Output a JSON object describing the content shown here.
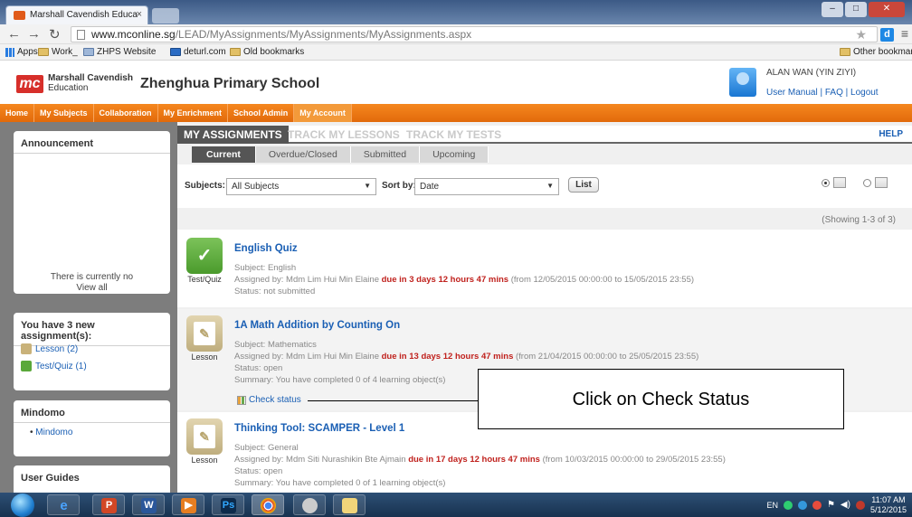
{
  "browser": {
    "tab_title": "Marshall Cavendish Educa",
    "tab_close": "×",
    "url_domain": "www.mconline.sg",
    "url_path": "/LEAD/MyAssignments/MyAssignments/MyAssignments.aspx",
    "bookmarks": [
      "Apps",
      "Work_",
      "ZHPS Website",
      "deturl.com",
      "Old bookmarks"
    ],
    "other_bookmarks": "Other bookmarks",
    "ext_label": "d"
  },
  "header": {
    "logo_mark": "mc",
    "brand_line1": "Marshall Cavendish",
    "brand_line2": "Education",
    "school_name": "Zhenghua Primary School",
    "user_name": "ALAN WAN (YIN ZIYI)",
    "user_links": "User Manual | FAQ | Logout"
  },
  "nav": [
    "Home",
    "My Subjects",
    "Collaboration",
    "My Enrichment",
    "School Admin",
    "My Account"
  ],
  "sidebar": {
    "announcement_title": "Announcement",
    "announcement_text": "There is currently no",
    "view_all": "View all",
    "new_assign_title": "You have 3 new assignment(s):",
    "lesson_link": "Lesson (2)",
    "testquiz_link": "Test/Quiz (1)",
    "mindomo_title": "Mindomo",
    "mindomo_link": "Mindomo",
    "guides_title": "User Guides"
  },
  "tabs": {
    "main": [
      "MY ASSIGNMENTS",
      "TRACK MY LESSONS",
      "TRACK MY TESTS"
    ],
    "help": "HELP",
    "sub": [
      "Current",
      "Overdue/Closed",
      "Submitted",
      "Upcoming"
    ]
  },
  "filters": {
    "subjects_label": "Subjects:",
    "subjects_value": "All Subjects",
    "sortby_label": "Sort by:",
    "sortby_value": "Date",
    "list_button": "List"
  },
  "showing": "(Showing 1-3 of 3)",
  "assignments": [
    {
      "type": "Test/Quiz",
      "title": "English Quiz",
      "subject": "Subject: English",
      "assigned_prefix": "Assigned by: Mdm Lim Hui Min Elaine",
      "due": "due in 3 days 12 hours 47 mins",
      "range": "(from 12/05/2015 00:00:00 to 15/05/2015 23:55)",
      "status": "Status: not submitted"
    },
    {
      "type": "Lesson",
      "title": "1A Math Addition by Counting On",
      "subject": "Subject: Mathematics",
      "assigned_prefix": "Assigned by: Mdm Lim Hui Min Elaine",
      "due": "due in 13 days 12 hours 47 mins",
      "range": "(from 21/04/2015 00:00:00 to 25/05/2015 23:55)",
      "status": "Status: open",
      "summary": "Summary: You have completed 0 of 4 learning object(s)",
      "check_status": "Check status"
    },
    {
      "type": "Lesson",
      "title": "Thinking Tool: SCAMPER - Level 1",
      "subject": "Subject: General",
      "assigned_prefix": "Assigned by: Mdm Siti Nurashikin Bte Ajmain",
      "due": "due in 17 days 12 hours 47 mins",
      "range": "(from 10/03/2015 00:00:00 to 29/05/2015 23:55)",
      "status": "Status: open",
      "summary": "Summary: You have completed 0 of 1 learning object(s)"
    }
  ],
  "callout": "Click on Check Status",
  "taskbar": {
    "lang": "EN",
    "time": "11:07 AM",
    "date": "5/12/2015"
  }
}
